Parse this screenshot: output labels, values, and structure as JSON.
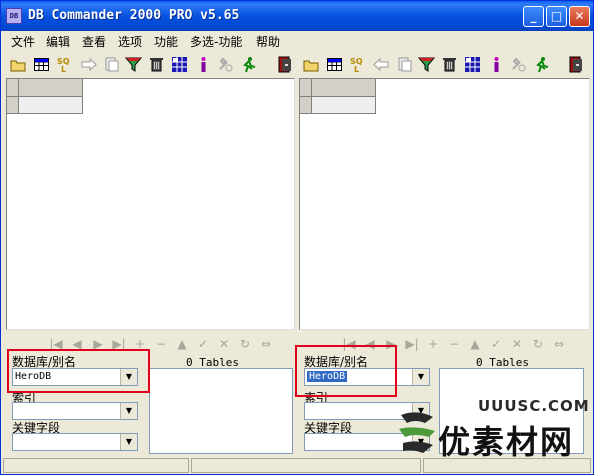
{
  "window": {
    "title": "DB Commander 2000 PRO v5.65",
    "app_icon_text": "DB",
    "minimize_glyph": "_",
    "maximize_glyph": "□",
    "close_glyph": "✕"
  },
  "menu": [
    "文件",
    "编辑",
    "查看",
    "选项",
    "功能",
    "多选-功能",
    "帮助"
  ],
  "toolbar_icons": [
    "open-folder-icon",
    "table-icon",
    "sql-icon",
    "arrow-right-icon",
    "copy-icon",
    "filter-icon",
    "delete-icon",
    "grid-icon",
    "info-icon",
    "tools-icon",
    "run-icon",
    "exit-icon"
  ],
  "toolbar_icons_right": [
    "open-folder-icon",
    "table-icon",
    "sql-icon",
    "arrow-left-icon",
    "copy-icon",
    "filter-icon",
    "delete-icon",
    "grid-icon",
    "info-icon",
    "tools-icon",
    "run-icon",
    "exit-icon"
  ],
  "nav_glyphs": [
    "|◀",
    "◀",
    "▶",
    "▶|",
    "+",
    "−",
    "▲",
    "✓",
    "✕",
    "↻",
    "⇔"
  ],
  "left_panel": {
    "database_label": "数据库/别名",
    "database_value": "HeroDB",
    "tables_count": "0 Tables",
    "index_label": "索引",
    "index_value": "",
    "key_label": "关键字段",
    "key_value": ""
  },
  "right_panel": {
    "database_label": "数据库/别名",
    "database_value": "HeroDB",
    "tables_count": "0 Tables",
    "index_label": "索引",
    "index_value": "",
    "key_label": "关键字段",
    "key_value": ""
  },
  "watermark": {
    "url": "UUUSC.COM",
    "text": "优素材网"
  },
  "colors": {
    "titlebar": "#0652e0",
    "highlight_box": "#e0001b",
    "selection": "#316ac5"
  }
}
